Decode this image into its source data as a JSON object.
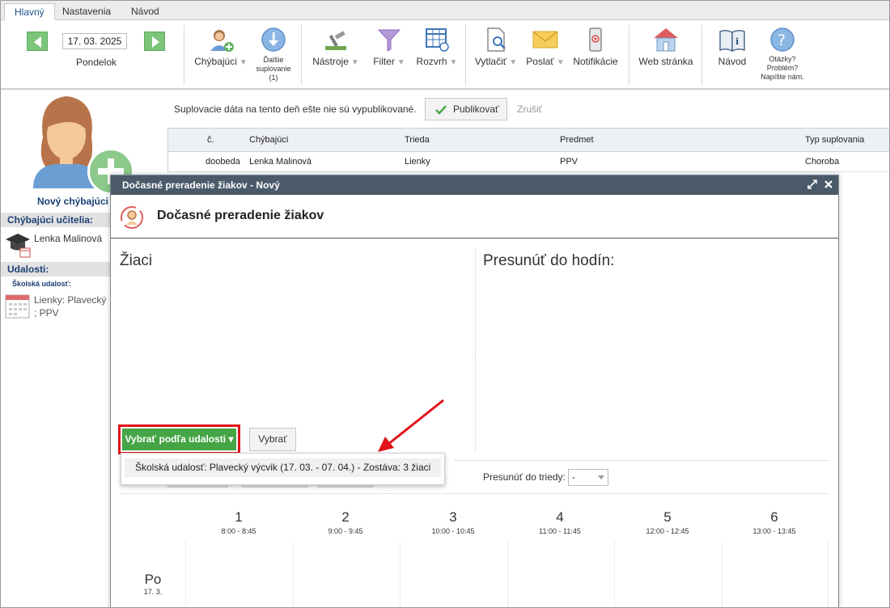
{
  "tabs": [
    {
      "label": "Hlavný",
      "active": true
    },
    {
      "label": "Nastavenia",
      "active": false
    },
    {
      "label": "Návod",
      "active": false
    }
  ],
  "ribbon": {
    "date": "17. 03. 2025",
    "day": "Pondelok",
    "buttons": {
      "chybajuci": "Chýbajúci",
      "dalsie_line1": "Ďalšie",
      "dalsie_line2": "suplovanie",
      "dalsie_line3": "(1)",
      "nastroje": "Nástroje",
      "filter": "Filter",
      "rozvrh": "Rozvrh",
      "vytlacit": "Vytlačiť",
      "poslat": "Poslať",
      "notifikacie": "Notifikácie",
      "web": "Web stránka",
      "navod": "Návod",
      "otazky1": "Otázky?",
      "otazky2": "Problém?",
      "otazky3": "Napíšte nám."
    }
  },
  "left_panel": {
    "new_absent": "Nový chýbajúci",
    "absent_teachers_heading": "Chýbajúci učitelia:",
    "teacher": "Lenka Malinová",
    "events_heading": "Udalosti:",
    "school_event_label": "Školská udalosť:",
    "event_line1": "Lienky: Plavecký",
    "event_line2": "; PPV"
  },
  "main": {
    "info": "Suplovacie dáta na tento deň ešte nie sú vypublikované.",
    "publish": "Publikovať",
    "cancel": "Zrušiť",
    "grid_headers": [
      "č.",
      "Chýbajúci",
      "Trieda",
      "Predmet",
      "Typ suplovania"
    ],
    "grid_row": [
      "doobeda",
      "Lenka Malinová",
      "Lienky",
      "PPV",
      "Choroba"
    ]
  },
  "dialog": {
    "window_title": "Dočasné preradenie žiakov - Nový",
    "header": "Dočasné preradenie žiakov",
    "students": "Žiaci",
    "move_to_lessons": "Presunúť do hodín:",
    "select_by_event": "Vybrať podľa udalosti",
    "select": "Vybrať",
    "dropdown_item": "Školská udalosť: Plavecký výcvik (17. 03. - 07. 04.) - Zostáva: 3 žiaci",
    "move_to_class": "Presunúť do triedy:",
    "move_to_class_value": "-",
    "periods": [
      {
        "num": "1",
        "time": "8:00 - 8:45"
      },
      {
        "num": "2",
        "time": "9:00 - 9:45"
      },
      {
        "num": "3",
        "time": "10:00 - 10:45"
      },
      {
        "num": "4",
        "time": "11:00 - 11:45"
      },
      {
        "num": "5",
        "time": "12:00 - 12:45"
      },
      {
        "num": "6",
        "time": "13:00 - 13:45"
      }
    ],
    "day_name": "Po",
    "day_date": "17. 3."
  },
  "colors": {
    "accent_green": "#45a545",
    "highlight_red": "#e0141b",
    "dialog_title_bg": "#4a5a69",
    "heading_blue": "#1a3f74"
  }
}
